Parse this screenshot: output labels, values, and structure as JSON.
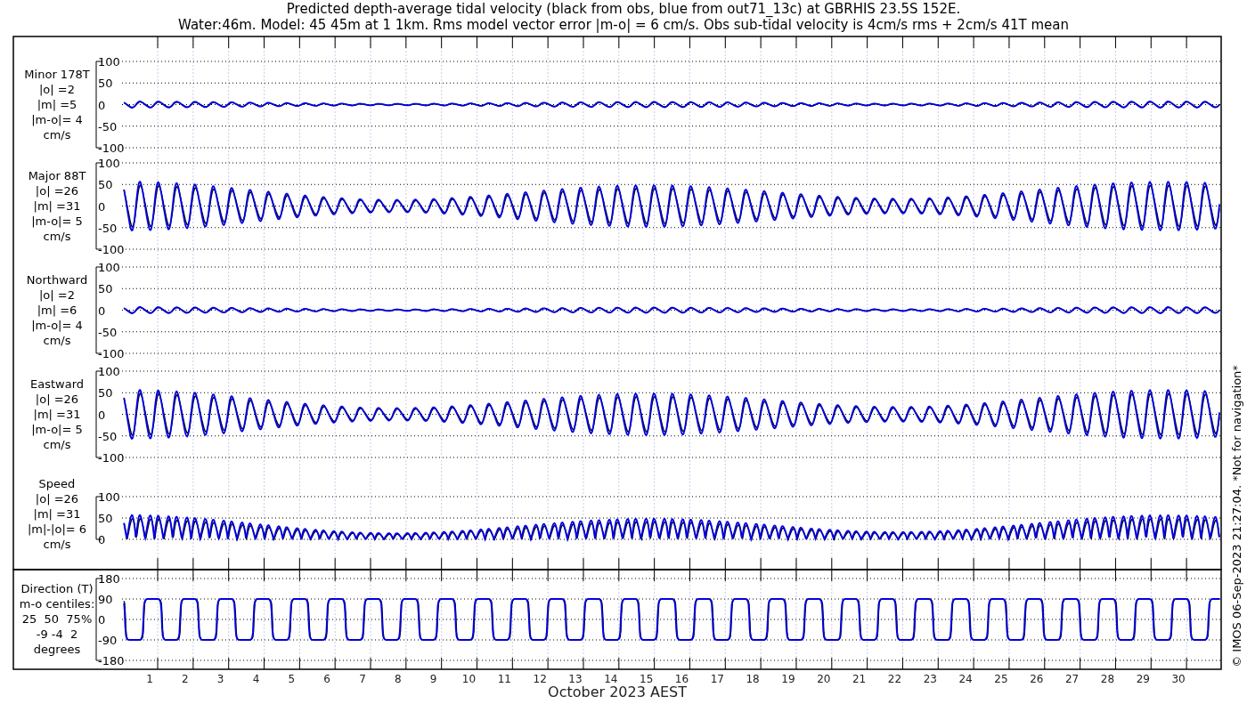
{
  "title": [
    "Predicted depth-average tidal velocity (black from obs, blue from out71_13c) at GBRHIS 23.5S 152E.",
    "Water:46m. Model: 45 45m at 1 1km. Rms model vector error |m-o| = 6 cm/s. Obs sub-tidal velocity is 4cm/s rms + 2cm/s 41T mean"
  ],
  "panels": [
    {
      "kind": "weak",
      "label": [
        "Minor 178T",
        "|o| =2",
        "|m| =5",
        "|m-o|= 4",
        "cm/s"
      ],
      "y_tick_labels": [
        "100",
        "50",
        "0",
        "-50",
        "-100"
      ]
    },
    {
      "kind": "strong",
      "label": [
        "Major 88T",
        "|o| =26",
        "|m| =31",
        "|m-o|= 5",
        "cm/s"
      ],
      "y_tick_labels": [
        "100",
        "50",
        "0",
        "-50",
        "-100"
      ]
    },
    {
      "kind": "weak",
      "label": [
        "Northward",
        "|o| =2",
        "|m| =6",
        "|m-o|= 4",
        "cm/s"
      ],
      "y_tick_labels": [
        "100",
        "50",
        "0",
        "-50",
        "-100"
      ]
    },
    {
      "kind": "strong",
      "label": [
        "Eastward",
        "|o| =26",
        "|m| =31",
        "|m-o|= 5",
        "cm/s"
      ],
      "y_tick_labels": [
        "100",
        "50",
        "0",
        "-50",
        "-100"
      ]
    },
    {
      "kind": "speed",
      "label": [
        "Speed",
        "|o| =26",
        "|m| =31",
        "|m|-|o|= 6",
        "cm/s"
      ],
      "y_tick_labels": [
        "100",
        "50",
        "0"
      ]
    },
    {
      "kind": "direction",
      "label": [
        "Direction (T)",
        "m-o centiles:",
        "25  50  75%",
        "-9 -4  2",
        "degrees"
      ],
      "y_tick_labels": [
        "180",
        "90",
        "0",
        "-90",
        "-180"
      ]
    }
  ],
  "x_tick_labels": [
    "1",
    "2",
    "3",
    "4",
    "5",
    "6",
    "7",
    "8",
    "9",
    "10",
    "11",
    "12",
    "13",
    "14",
    "15",
    "16",
    "17",
    "18",
    "19",
    "20",
    "21",
    "22",
    "23",
    "24",
    "25",
    "26",
    "27",
    "28",
    "29",
    "30"
  ],
  "x_axis_title": "October 2023 AEST",
  "footer_note": "© IMOS 06-Sep-2023 21:27:04. *Not for navigation*"
}
